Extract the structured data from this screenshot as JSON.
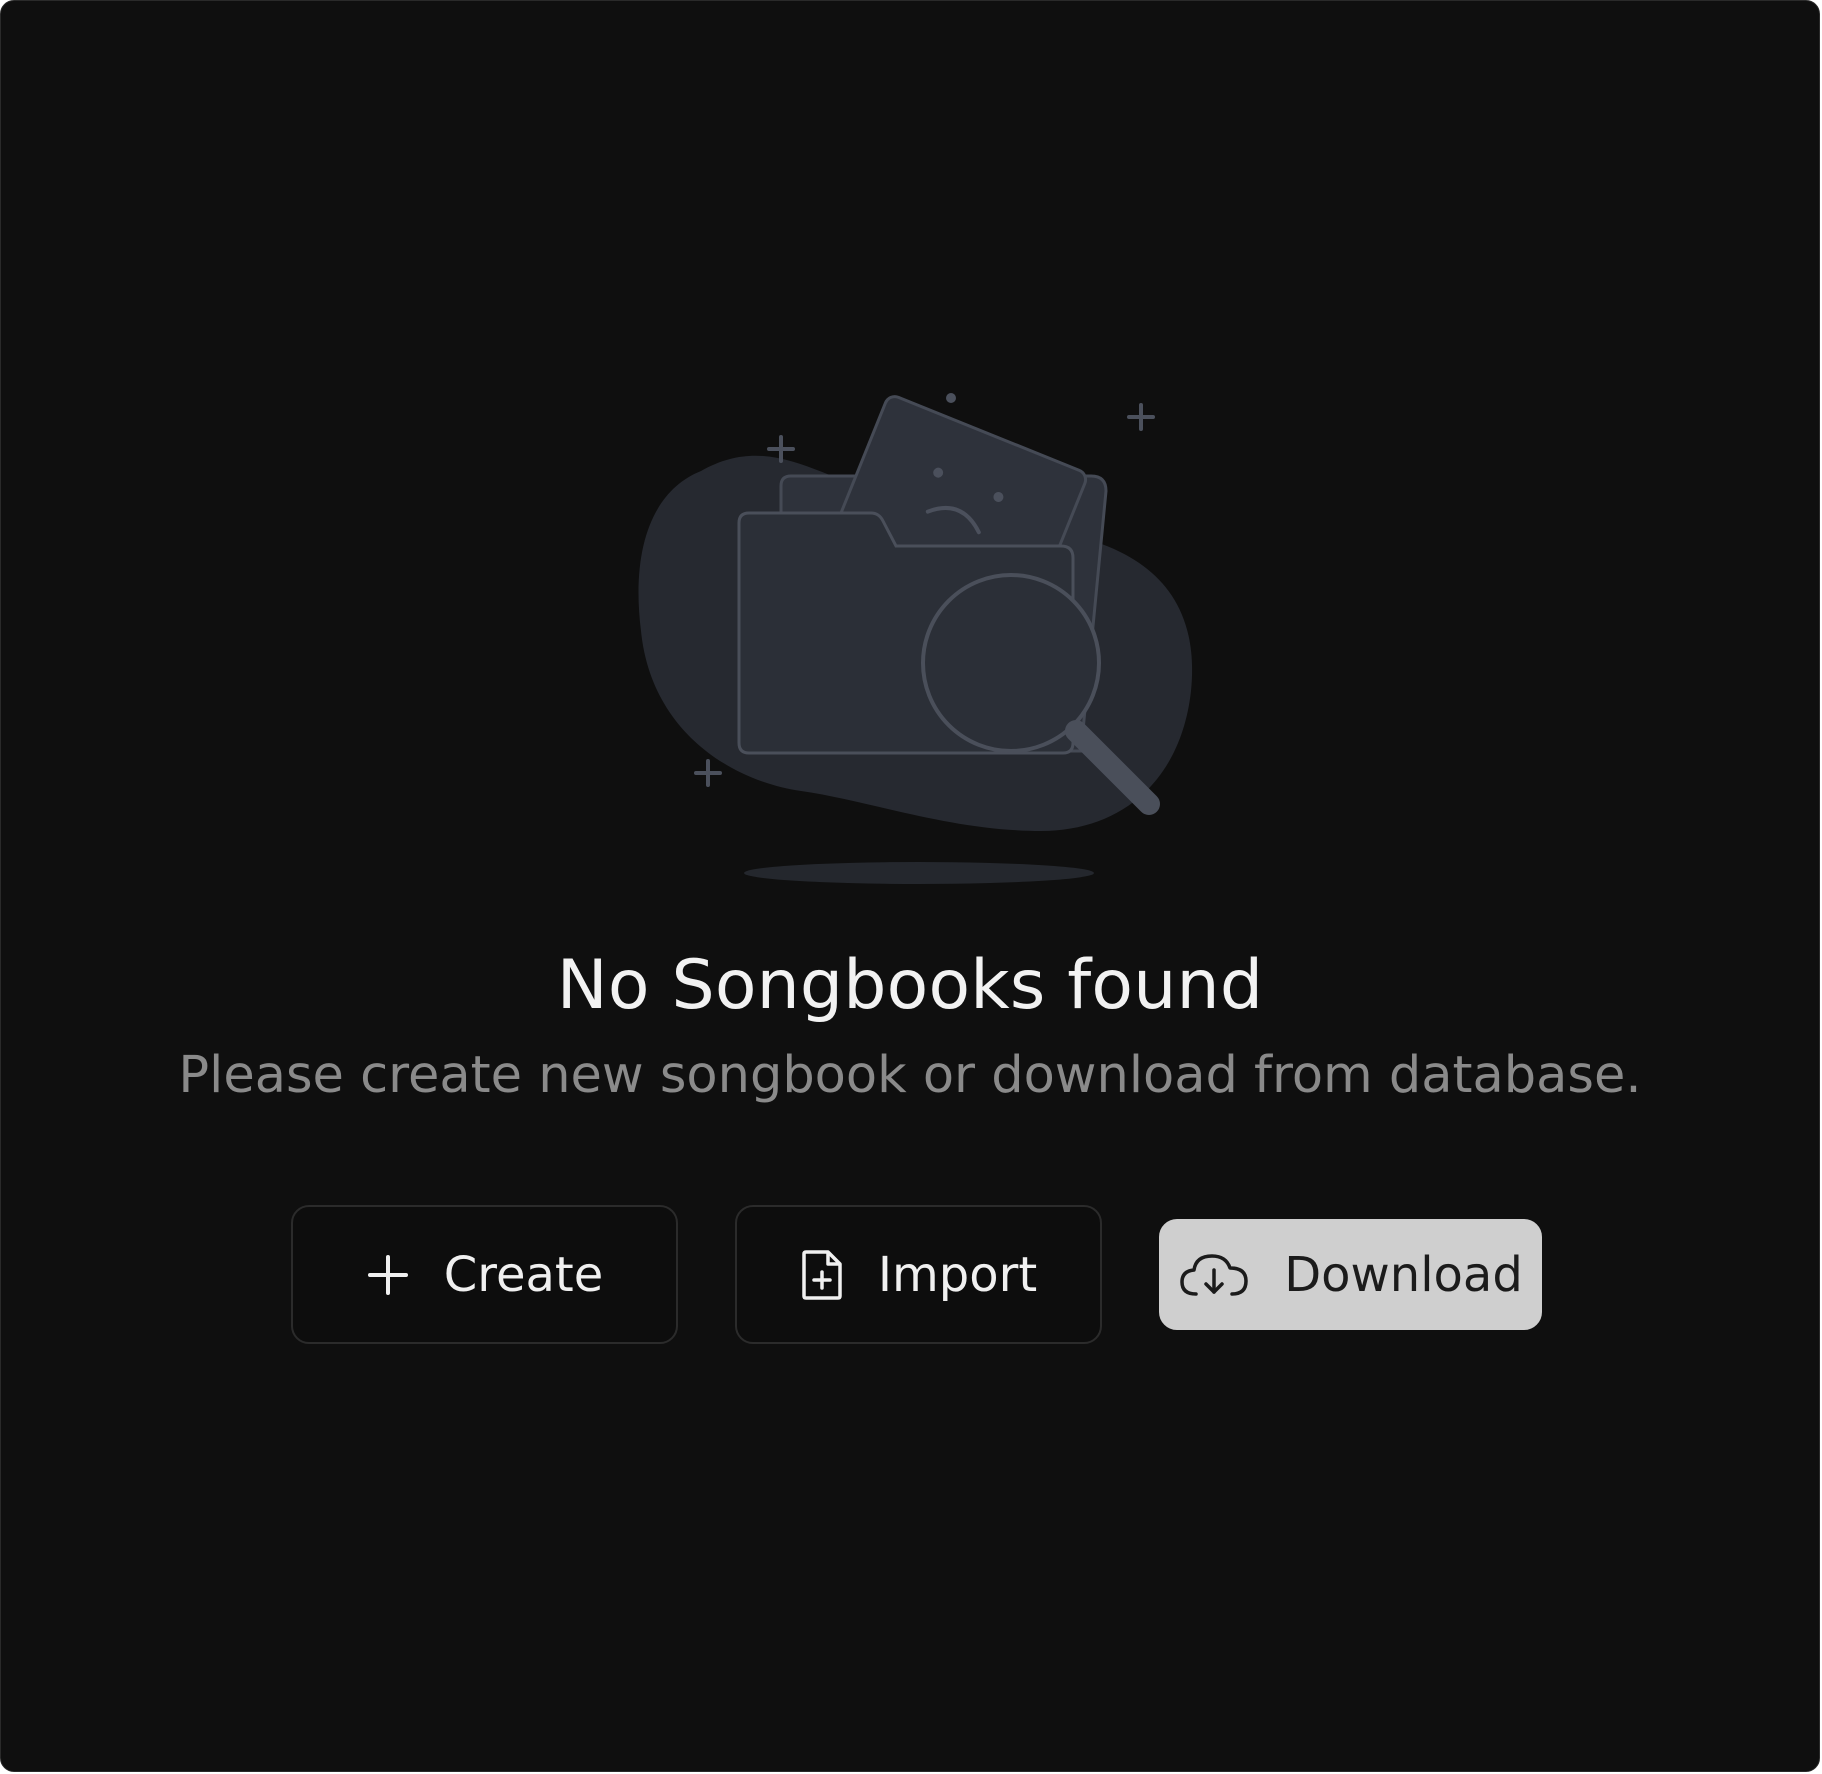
{
  "empty_state": {
    "title": "No Songbooks found",
    "message": "Please create new songbook or download from database."
  },
  "actions": {
    "create_label": "Create",
    "create_icon": "plus-icon",
    "import_label": "Import",
    "import_icon": "file-plus-icon",
    "download_label": "Download",
    "download_icon": "cloud-download-icon"
  },
  "colors": {
    "background": "#0f0f0f",
    "title": "#f2f2f2",
    "subtitle": "#8a8a8a",
    "primary_button": "#cfcfcf",
    "illustration_fill": "#2a2d35"
  }
}
